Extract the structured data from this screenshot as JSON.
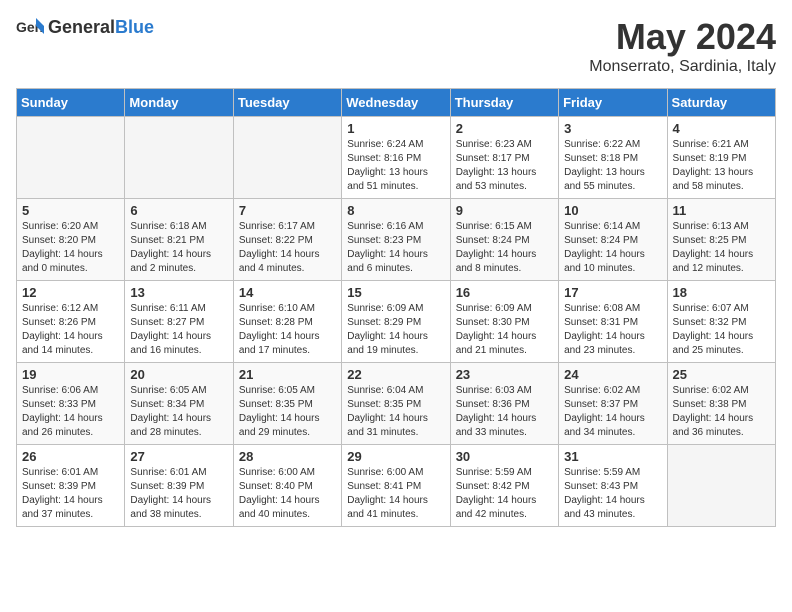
{
  "header": {
    "logo_general": "General",
    "logo_blue": "Blue",
    "month_title": "May 2024",
    "location": "Monserrato, Sardinia, Italy"
  },
  "days_of_week": [
    "Sunday",
    "Monday",
    "Tuesday",
    "Wednesday",
    "Thursday",
    "Friday",
    "Saturday"
  ],
  "weeks": [
    [
      {
        "day": "",
        "info": ""
      },
      {
        "day": "",
        "info": ""
      },
      {
        "day": "",
        "info": ""
      },
      {
        "day": "1",
        "info": "Sunrise: 6:24 AM\nSunset: 8:16 PM\nDaylight: 13 hours\nand 51 minutes."
      },
      {
        "day": "2",
        "info": "Sunrise: 6:23 AM\nSunset: 8:17 PM\nDaylight: 13 hours\nand 53 minutes."
      },
      {
        "day": "3",
        "info": "Sunrise: 6:22 AM\nSunset: 8:18 PM\nDaylight: 13 hours\nand 55 minutes."
      },
      {
        "day": "4",
        "info": "Sunrise: 6:21 AM\nSunset: 8:19 PM\nDaylight: 13 hours\nand 58 minutes."
      }
    ],
    [
      {
        "day": "5",
        "info": "Sunrise: 6:20 AM\nSunset: 8:20 PM\nDaylight: 14 hours\nand 0 minutes."
      },
      {
        "day": "6",
        "info": "Sunrise: 6:18 AM\nSunset: 8:21 PM\nDaylight: 14 hours\nand 2 minutes."
      },
      {
        "day": "7",
        "info": "Sunrise: 6:17 AM\nSunset: 8:22 PM\nDaylight: 14 hours\nand 4 minutes."
      },
      {
        "day": "8",
        "info": "Sunrise: 6:16 AM\nSunset: 8:23 PM\nDaylight: 14 hours\nand 6 minutes."
      },
      {
        "day": "9",
        "info": "Sunrise: 6:15 AM\nSunset: 8:24 PM\nDaylight: 14 hours\nand 8 minutes."
      },
      {
        "day": "10",
        "info": "Sunrise: 6:14 AM\nSunset: 8:24 PM\nDaylight: 14 hours\nand 10 minutes."
      },
      {
        "day": "11",
        "info": "Sunrise: 6:13 AM\nSunset: 8:25 PM\nDaylight: 14 hours\nand 12 minutes."
      }
    ],
    [
      {
        "day": "12",
        "info": "Sunrise: 6:12 AM\nSunset: 8:26 PM\nDaylight: 14 hours\nand 14 minutes."
      },
      {
        "day": "13",
        "info": "Sunrise: 6:11 AM\nSunset: 8:27 PM\nDaylight: 14 hours\nand 16 minutes."
      },
      {
        "day": "14",
        "info": "Sunrise: 6:10 AM\nSunset: 8:28 PM\nDaylight: 14 hours\nand 17 minutes."
      },
      {
        "day": "15",
        "info": "Sunrise: 6:09 AM\nSunset: 8:29 PM\nDaylight: 14 hours\nand 19 minutes."
      },
      {
        "day": "16",
        "info": "Sunrise: 6:09 AM\nSunset: 8:30 PM\nDaylight: 14 hours\nand 21 minutes."
      },
      {
        "day": "17",
        "info": "Sunrise: 6:08 AM\nSunset: 8:31 PM\nDaylight: 14 hours\nand 23 minutes."
      },
      {
        "day": "18",
        "info": "Sunrise: 6:07 AM\nSunset: 8:32 PM\nDaylight: 14 hours\nand 25 minutes."
      }
    ],
    [
      {
        "day": "19",
        "info": "Sunrise: 6:06 AM\nSunset: 8:33 PM\nDaylight: 14 hours\nand 26 minutes."
      },
      {
        "day": "20",
        "info": "Sunrise: 6:05 AM\nSunset: 8:34 PM\nDaylight: 14 hours\nand 28 minutes."
      },
      {
        "day": "21",
        "info": "Sunrise: 6:05 AM\nSunset: 8:35 PM\nDaylight: 14 hours\nand 29 minutes."
      },
      {
        "day": "22",
        "info": "Sunrise: 6:04 AM\nSunset: 8:35 PM\nDaylight: 14 hours\nand 31 minutes."
      },
      {
        "day": "23",
        "info": "Sunrise: 6:03 AM\nSunset: 8:36 PM\nDaylight: 14 hours\nand 33 minutes."
      },
      {
        "day": "24",
        "info": "Sunrise: 6:02 AM\nSunset: 8:37 PM\nDaylight: 14 hours\nand 34 minutes."
      },
      {
        "day": "25",
        "info": "Sunrise: 6:02 AM\nSunset: 8:38 PM\nDaylight: 14 hours\nand 36 minutes."
      }
    ],
    [
      {
        "day": "26",
        "info": "Sunrise: 6:01 AM\nSunset: 8:39 PM\nDaylight: 14 hours\nand 37 minutes."
      },
      {
        "day": "27",
        "info": "Sunrise: 6:01 AM\nSunset: 8:39 PM\nDaylight: 14 hours\nand 38 minutes."
      },
      {
        "day": "28",
        "info": "Sunrise: 6:00 AM\nSunset: 8:40 PM\nDaylight: 14 hours\nand 40 minutes."
      },
      {
        "day": "29",
        "info": "Sunrise: 6:00 AM\nSunset: 8:41 PM\nDaylight: 14 hours\nand 41 minutes."
      },
      {
        "day": "30",
        "info": "Sunrise: 5:59 AM\nSunset: 8:42 PM\nDaylight: 14 hours\nand 42 minutes."
      },
      {
        "day": "31",
        "info": "Sunrise: 5:59 AM\nSunset: 8:43 PM\nDaylight: 14 hours\nand 43 minutes."
      },
      {
        "day": "",
        "info": ""
      }
    ]
  ]
}
